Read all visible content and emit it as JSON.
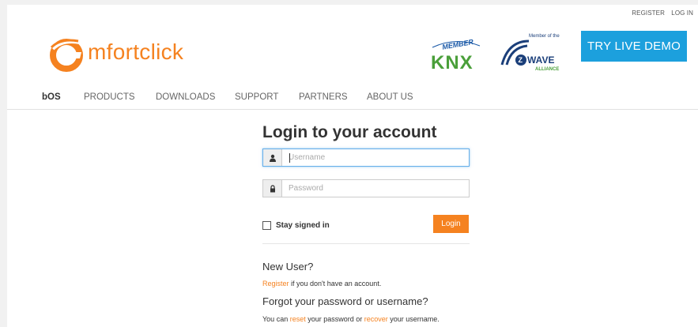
{
  "top_links": {
    "register": "REGISTER",
    "login": "LOG IN"
  },
  "logo": {
    "text": "mfortclick"
  },
  "badges": {
    "knx_member": "MEMBER",
    "knx": "KNX",
    "zwave_member": "Member of the",
    "zwave": "WAVE",
    "zwave_alliance": "ALLIANCE"
  },
  "demo_button": "TRY LIVE DEMO",
  "nav": {
    "items": [
      {
        "label": "bOS"
      },
      {
        "label": "PRODUCTS"
      },
      {
        "label": "DOWNLOADS"
      },
      {
        "label": "SUPPORT"
      },
      {
        "label": "PARTNERS"
      },
      {
        "label": "ABOUT US"
      }
    ]
  },
  "login": {
    "title": "Login to your account",
    "username_placeholder": "Username",
    "password_placeholder": "Password",
    "remember_label": "Stay signed in",
    "submit": "Login"
  },
  "new_user": {
    "heading": "New User?",
    "register_link": "Register",
    "register_suffix": " if you don't have an account."
  },
  "forgot": {
    "heading": "Forgot your password or username?",
    "prefix": "You can ",
    "reset_link": "reset",
    "middle": " your password or ",
    "recover_link": "recover",
    "suffix": " your username."
  },
  "colors": {
    "brand_orange": "#f58220",
    "demo_blue": "#1ca0dd"
  }
}
